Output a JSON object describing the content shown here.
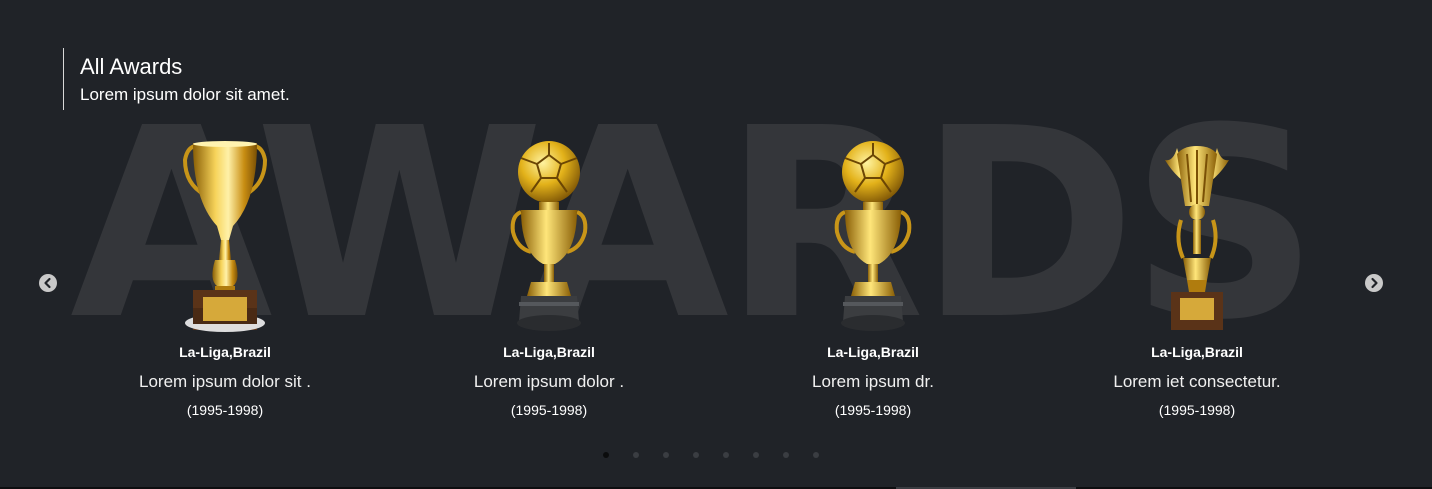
{
  "section": {
    "watermark": "AWARDS",
    "title": "All Awards",
    "subtitle": "Lorem ipsum dolor sit amet."
  },
  "awards": [
    {
      "league": "La-Liga,Brazil",
      "description": "Lorem ipsum dolor sit .",
      "years": "(1995-1998)",
      "trophy_icon": "cup-trophy-icon"
    },
    {
      "league": "La-Liga,Brazil",
      "description": "Lorem ipsum dolor .",
      "years": "(1995-1998)",
      "trophy_icon": "ball-trophy-icon"
    },
    {
      "league": "La-Liga,Brazil",
      "description": "Lorem ipsum dr.",
      "years": "(1995-1998)",
      "trophy_icon": "ball-trophy-icon"
    },
    {
      "league": "La-Liga,Brazil",
      "description": "Lorem iet consectetur.",
      "years": "(1995-1998)",
      "trophy_icon": "winged-trophy-icon"
    }
  ],
  "carousel": {
    "page_count": 8,
    "active_page": 1
  },
  "colors": {
    "background": "#202328",
    "watermark": "#34363a",
    "gold": "#d4a514",
    "text": "#ffffff"
  }
}
